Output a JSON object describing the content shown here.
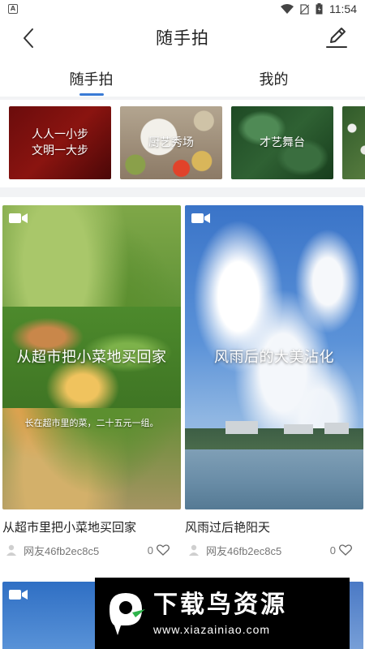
{
  "status_bar": {
    "time": "11:54",
    "left_badge": "A"
  },
  "header": {
    "title": "随手拍"
  },
  "tabs": [
    {
      "label": "随手拍",
      "active": true
    },
    {
      "label": "我的",
      "active": false
    }
  ],
  "categories": [
    {
      "label": "人人一小步\n文明一大步"
    },
    {
      "label": "厨艺秀场"
    },
    {
      "label": "才艺舞台"
    },
    {
      "label": ""
    }
  ],
  "posts": [
    {
      "overlay_title": "从超市把小菜地买回家",
      "overlay_subtitle": "长在超市里的菜，二十五元一组。",
      "title": "从超市里把小菜地买回家",
      "author": "网友46fb2ec8c5",
      "likes": "0"
    },
    {
      "overlay_title": "风雨后的大美沾化",
      "overlay_subtitle": "",
      "title": "风雨过后艳阳天",
      "author": "网友46fb2ec8c5",
      "likes": "0"
    }
  ],
  "watermark": {
    "text": "下载鸟资源",
    "url": "www.xiazainiao.com"
  },
  "colors": {
    "accent": "#3a7bd5",
    "divider": "#f2f3f5"
  }
}
